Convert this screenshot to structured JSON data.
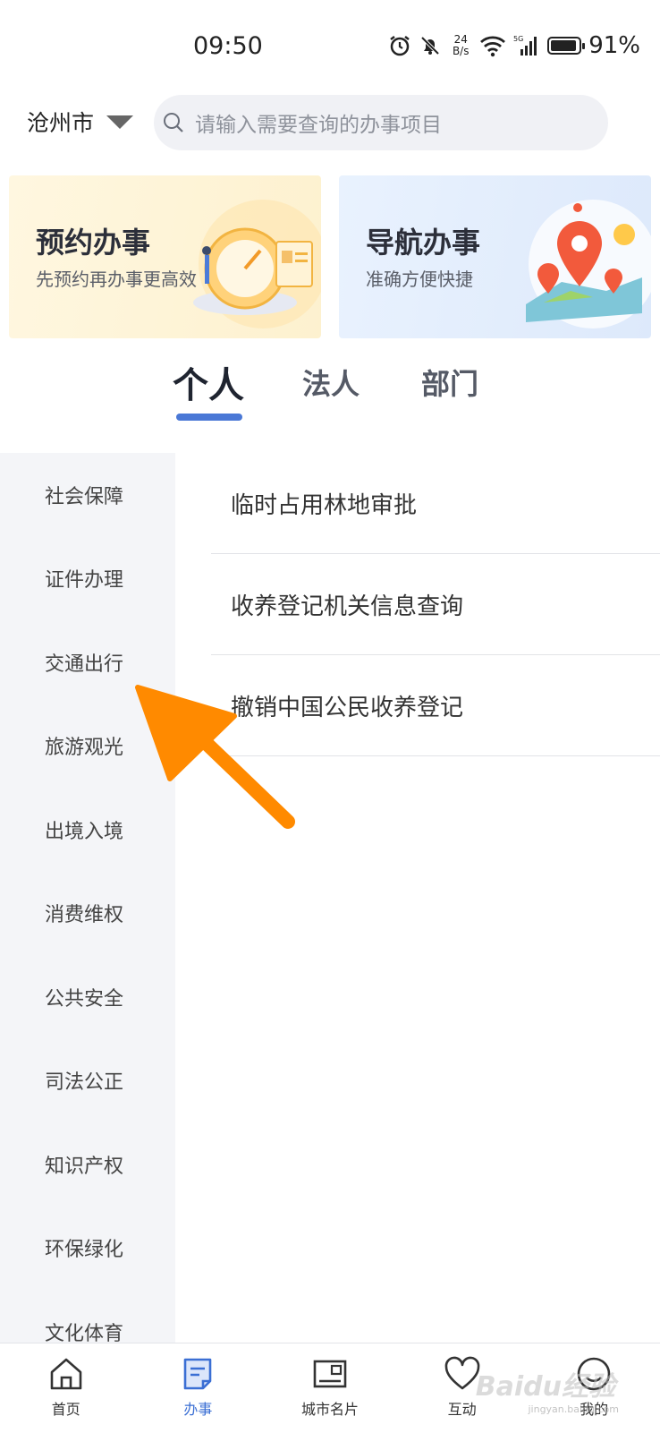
{
  "status_bar": {
    "time": "09:50",
    "net_speed_value": "24",
    "net_speed_unit": "B/s",
    "signal_tag": "5G",
    "battery_level": 0.91,
    "battery_pct": "91%"
  },
  "header": {
    "city": "沧州市",
    "search_placeholder": "请输入需要查询的办事项目"
  },
  "banners": [
    {
      "title": "预约办事",
      "subtitle": "先预约再办事更高效"
    },
    {
      "title": "导航办事",
      "subtitle": "准确方便快捷"
    }
  ],
  "tabs": [
    {
      "label": "个人",
      "active": true
    },
    {
      "label": "法人"
    },
    {
      "label": "部门"
    }
  ],
  "categories": [
    "社会保障",
    "证件办理",
    "交通出行",
    "旅游观光",
    "出境入境",
    "消费维权",
    "公共安全",
    "司法公正",
    "知识产权",
    "环保绿化",
    "文化体育"
  ],
  "services": [
    "临时占用林地审批",
    "收养登记机关信息查询",
    "撤销中国公民收养登记"
  ],
  "bottom_nav": [
    {
      "label": "首页",
      "icon": "home-icon"
    },
    {
      "label": "办事",
      "icon": "document-icon",
      "active": true
    },
    {
      "label": "城市名片",
      "icon": "city-card-icon"
    },
    {
      "label": "互动",
      "icon": "heart-icon"
    },
    {
      "label": "我的",
      "icon": "profile-icon"
    }
  ],
  "watermark": {
    "text": "Baidu经验",
    "sub": "jingyan.baidu.com"
  },
  "colors": {
    "accent": "#4a78d6",
    "arrow": "#ff8a00",
    "sidebar_bg": "#f4f5f8"
  }
}
